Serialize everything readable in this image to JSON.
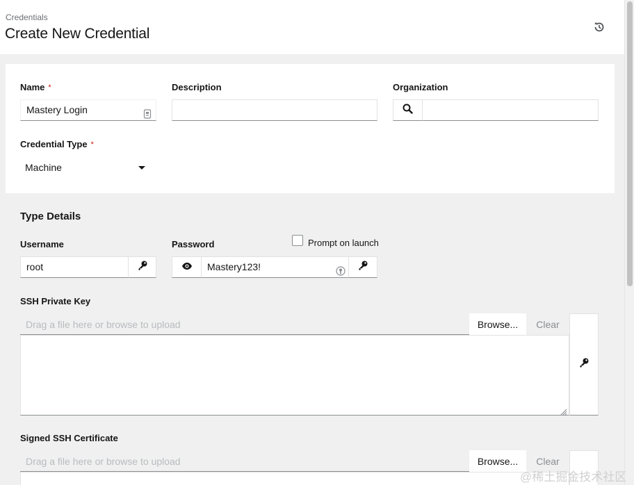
{
  "header": {
    "breadcrumb": "Credentials",
    "title": "Create New Credential",
    "history_icon": "history-icon"
  },
  "form": {
    "name": {
      "label": "Name",
      "required_mark": "*",
      "value": "Mastery Login"
    },
    "description": {
      "label": "Description",
      "value": ""
    },
    "organization": {
      "label": "Organization",
      "value": ""
    },
    "credential_type": {
      "label": "Credential Type",
      "required_mark": "*",
      "value": "Machine"
    }
  },
  "type_details": {
    "title": "Type Details",
    "username": {
      "label": "Username",
      "value": "root"
    },
    "password": {
      "label": "Password",
      "value": "Mastery123!"
    },
    "prompt_on_launch": {
      "label": "Prompt on launch",
      "checked": false
    },
    "ssh_private_key": {
      "label": "SSH Private Key",
      "placeholder": "Drag a file here or browse to upload",
      "browse_label": "Browse...",
      "clear_label": "Clear"
    },
    "signed_ssh_certificate": {
      "label": "Signed SSH Certificate",
      "placeholder": "Drag a file here or browse to upload",
      "browse_label": "Browse...",
      "clear_label": "Clear"
    }
  },
  "watermark": "@稀土掘金技术社区",
  "colors": {
    "required": "#c9190b",
    "border_bottom": "#8a8d90",
    "background": "#f0f0f0"
  }
}
